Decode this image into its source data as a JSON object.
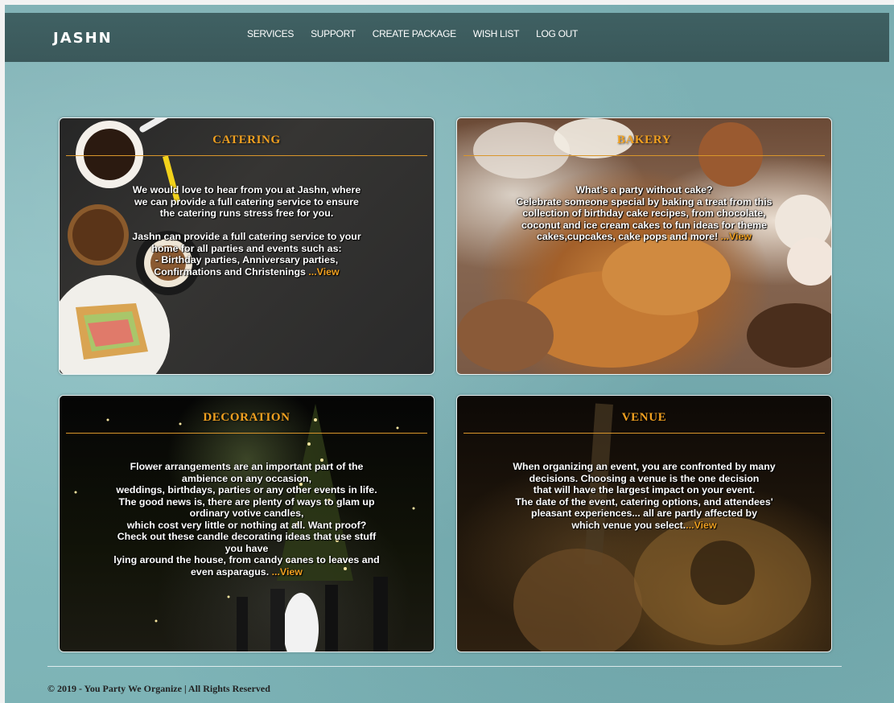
{
  "brand": {
    "name": "JASHN"
  },
  "nav": {
    "items": [
      {
        "label": "SERVICES"
      },
      {
        "label": "SUPPORT"
      },
      {
        "label": "CREATE PACKAGE"
      },
      {
        "label": "WISH LIST"
      },
      {
        "label": "LOG OUT"
      }
    ]
  },
  "cards": {
    "catering": {
      "title": "CATERING",
      "lines": [
        "We would love to hear from you at Jashn, where",
        "we can provide a full catering service to ensure",
        "the catering runs stress free for you.",
        "",
        "Jashn can provide a full catering service to your",
        "home for all parties and events such as:",
        "- Birthday parties, Anniversary parties,"
      ],
      "last_line": "Confirmations and Christenings",
      "view": "...View"
    },
    "bakery": {
      "title": "BAKERY",
      "lines": [
        "What's a party without cake?",
        "Celebrate someone special by baking a treat from this",
        "collection of birthday cake recipes, from chocolate,",
        "coconut and ice cream cakes to fun ideas for theme"
      ],
      "last_line": "cakes,cupcakes, cake pops and more!",
      "view": "...View"
    },
    "decoration": {
      "title": "DECORATION",
      "lines": [
        "Flower arrangements are an important part of the",
        "ambience on any occasion,",
        "weddings, birthdays, parties or any other events in life.",
        "The good news is, there are plenty of ways to glam up",
        "ordinary votive candles,",
        "which cost very little or nothing at all. Want proof?",
        "Check out these candle decorating ideas that use stuff",
        "you have",
        "lying around the house, from candy canes to leaves and"
      ],
      "last_line": "even asparagus.",
      "view": "...View"
    },
    "venue": {
      "title": "VENUE",
      "lines": [
        "When organizing an event, you are confronted by many",
        "decisions. Choosing a venue is the one decision",
        "that will have the largest impact on your event.",
        "The date of the event, catering options, and attendees'",
        "pleasant experiences... all are partly affected by"
      ],
      "last_line": "which venue you select.",
      "view": "...View"
    }
  },
  "footer": {
    "text": "© 2019 - You Party We Organize | All Rights Reserved"
  },
  "colors": {
    "accent": "#f0a020",
    "navbar": "#3a5a5c",
    "background": "#80b6b9"
  }
}
